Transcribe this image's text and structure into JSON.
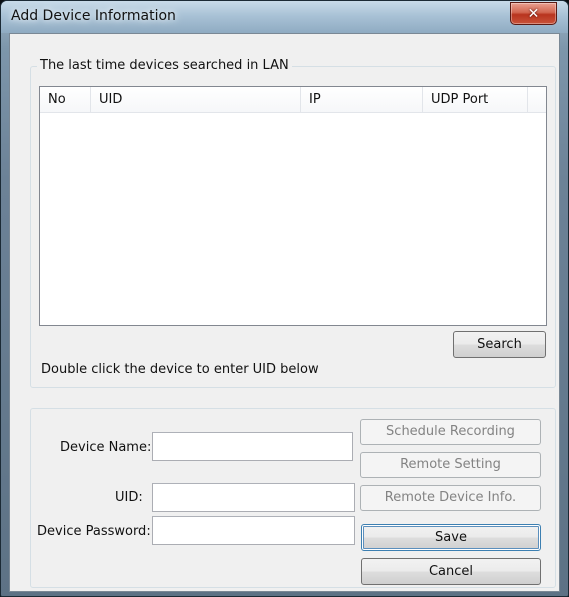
{
  "window": {
    "title": "Add Device Information",
    "close_glyph": "✕"
  },
  "search_group": {
    "label": "The last time devices searched in LAN",
    "columns": [
      "No",
      "UID",
      "IP",
      "UDP Port"
    ],
    "rows": [],
    "search_button": "Search",
    "hint": "Double click the device to enter UID below"
  },
  "form": {
    "device_name_label": "Device Name:",
    "device_name_value": "",
    "uid_label": "UID:",
    "uid_value": "",
    "password_label": "Device Password:",
    "password_value": ""
  },
  "buttons": {
    "schedule_recording": "Schedule Recording",
    "remote_setting": "Remote Setting",
    "remote_device_info": "Remote Device Info.",
    "save": "Save",
    "cancel": "Cancel"
  },
  "icons": {
    "close": "close-icon"
  }
}
